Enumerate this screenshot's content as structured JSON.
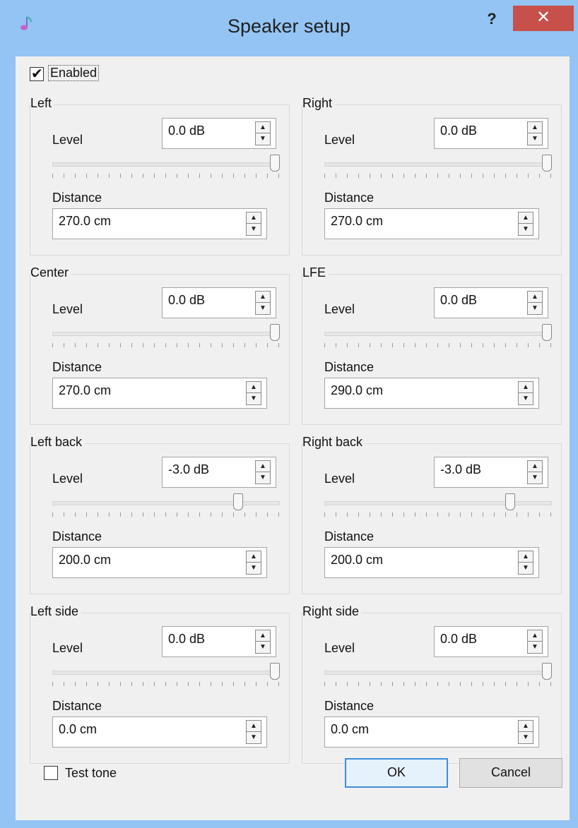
{
  "window": {
    "title": "Speaker setup",
    "help_label": "?",
    "close_label": "✕"
  },
  "enabled": {
    "label": "Enabled",
    "checked": true
  },
  "common": {
    "level_label": "Level",
    "distance_label": "Distance",
    "up_arrow": "▲",
    "down_arrow": "▼"
  },
  "speakers": [
    {
      "name": "Left",
      "level": "0.0 dB",
      "level_fraction": 1.0,
      "distance": "270.0 cm"
    },
    {
      "name": "Right",
      "level": "0.0 dB",
      "level_fraction": 1.0,
      "distance": "270.0 cm"
    },
    {
      "name": "Center",
      "level": "0.0 dB",
      "level_fraction": 1.0,
      "distance": "270.0 cm"
    },
    {
      "name": "LFE",
      "level": "0.0 dB",
      "level_fraction": 1.0,
      "distance": "290.0 cm"
    },
    {
      "name": "Left back",
      "level": "-3.0 dB",
      "level_fraction": 0.83,
      "distance": "200.0 cm"
    },
    {
      "name": "Right back",
      "level": "-3.0 dB",
      "level_fraction": 0.83,
      "distance": "200.0 cm"
    },
    {
      "name": "Left side",
      "level": "0.0 dB",
      "level_fraction": 1.0,
      "distance": "0.0 cm"
    },
    {
      "name": "Right side",
      "level": "0.0 dB",
      "level_fraction": 1.0,
      "distance": "0.0 cm"
    }
  ],
  "test_tone": {
    "label": "Test tone",
    "checked": false
  },
  "buttons": {
    "ok": "OK",
    "cancel": "Cancel"
  },
  "colors": {
    "titlebar": "#93c4f4",
    "close": "#c7504a",
    "default_button_border": "#3c8ed8"
  }
}
